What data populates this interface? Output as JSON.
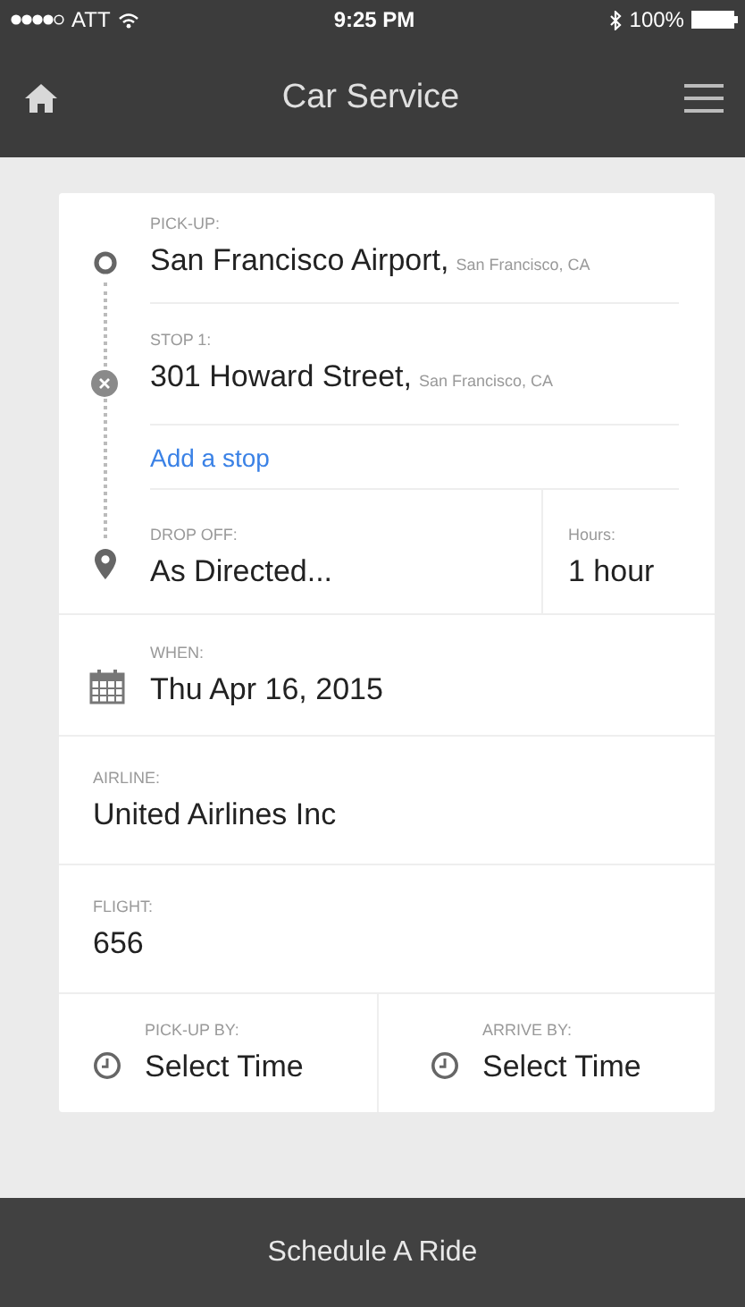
{
  "status_bar": {
    "carrier": "ATT",
    "time": "9:25 PM",
    "battery": "100%"
  },
  "nav": {
    "title": "Car Service"
  },
  "route": {
    "stops": [
      {
        "kind": "origin",
        "label": "PICK-UP:",
        "place": "San Francisco Airport,",
        "city": "San Francisco, CA"
      },
      {
        "kind": "stop",
        "label": "STOP 1:",
        "place": "301 Howard Street,",
        "city": "San Francisco, CA"
      }
    ],
    "add_stop": "Add a stop",
    "dropoff": {
      "kind": "destination",
      "label": "DROP OFF:",
      "place": "As Directed..."
    },
    "hours": {
      "label": "Hours:",
      "value": "1 hour"
    }
  },
  "fields": [
    {
      "kind": "date",
      "label": "WHEN:",
      "value": "Thu Apr 16, 2015"
    },
    {
      "kind": "text",
      "label": "AIRLINE:",
      "value": "United Airlines Inc"
    },
    {
      "kind": "text",
      "label": "FLIGHT:",
      "value": "656"
    }
  ],
  "times": [
    {
      "label": "PICK-UP BY:",
      "value": "Select Time"
    },
    {
      "label": "ARRIVE BY:",
      "value": "Select Time"
    }
  ],
  "action_button": "Schedule A Ride"
}
